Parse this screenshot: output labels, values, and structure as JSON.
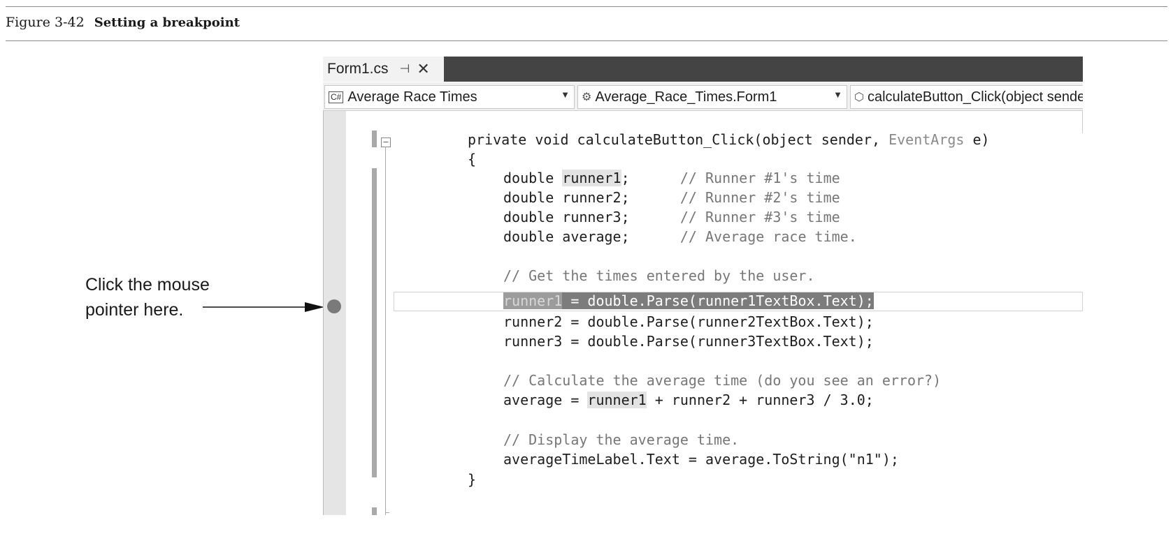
{
  "figure": {
    "number": "Figure 3-42",
    "title": "Setting a breakpoint"
  },
  "callout": {
    "line1": "Click the mouse",
    "line2": "pointer here."
  },
  "ide": {
    "tab": {
      "label": "Form1.cs",
      "pin_glyph": "⊣",
      "close_glyph": "✕"
    },
    "navigation": {
      "project": "Average Race Times",
      "project_icon": "C#",
      "class": "Average_Race_Times.Form1",
      "member": "calculateButton_Click(object sender, EventArgs e)"
    },
    "code": {
      "l1": {
        "kw": "private void ",
        "name": "calculateButton_Click(",
        "p1": "object",
        "p2": " sender, ",
        "type": "EventArgs",
        "p3": " e)"
      },
      "l2": "{",
      "l3": {
        "a": "double ",
        "b": "runner1",
        "c": ";      ",
        "cm": "// Runner #1's time"
      },
      "l4": {
        "a": "double runner2;      ",
        "cm": "// Runner #2's time"
      },
      "l5": {
        "a": "double runner3;      ",
        "cm": "// Runner #3's time"
      },
      "l6": {
        "a": "double average;      ",
        "cm": "// Average race time."
      },
      "l7": "// Get the times entered by the user.",
      "l8": {
        "a": "runner1",
        "b": " = double.Parse(runner1TextBox.Text);"
      },
      "l9": "runner2 = double.Parse(runner2TextBox.Text);",
      "l10": "runner3 = double.Parse(runner3TextBox.Text);",
      "l11": "// Calculate the average time (do you see an error?)",
      "l12": {
        "a": "average = ",
        "b": "runner1",
        "c": " + runner2 + runner3 / 3.0;"
      },
      "l13": "// Display the average time.",
      "l14": "averageTimeLabel.Text = average.ToString(\"n1\");",
      "l15": "}"
    }
  }
}
